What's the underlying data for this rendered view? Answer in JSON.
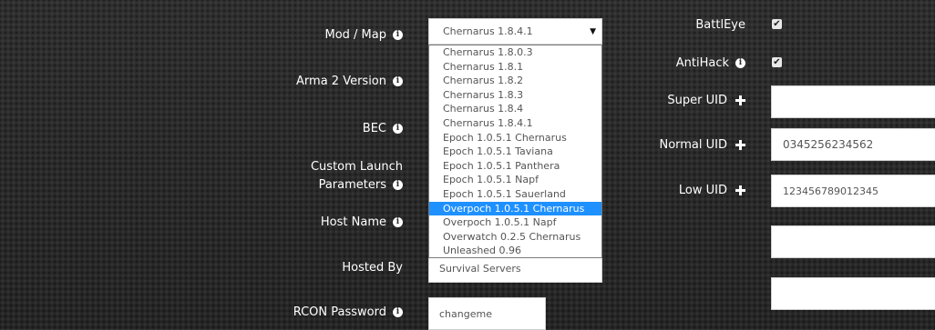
{
  "labels": {
    "mod_map": "Mod / Map",
    "arma2_version": "Arma 2 Version",
    "bec": "BEC",
    "custom_launch_line1": "Custom Launch",
    "custom_launch_line2": "Parameters",
    "host_name": "Host Name",
    "hosted_by": "Hosted By",
    "rcon_password": "RCON Password",
    "battleye": "BattlEye",
    "antihack": "AntiHack",
    "super_uid": "Super UID",
    "normal_uid": "Normal UID",
    "low_uid": "Low UID"
  },
  "mod_map_select": {
    "selected_value": "Chernarus 1.8.4.1",
    "options": [
      "Chernarus 1.8.0.3",
      "Chernarus 1.8.1",
      "Chernarus 1.8.2",
      "Chernarus 1.8.3",
      "Chernarus 1.8.4",
      "Chernarus 1.8.4.1",
      "Epoch 1.0.5.1 Chernarus",
      "Epoch 1.0.5.1 Taviana",
      "Epoch 1.0.5.1 Panthera",
      "Epoch 1.0.5.1 Napf",
      "Epoch 1.0.5.1 Sauerland",
      "Overpoch 1.0.5.1 Chernarus",
      "Overpoch 1.0.5.1 Napf",
      "Overwatch 0.2.5 Chernarus",
      "Unleashed 0.96"
    ],
    "highlighted": "Overpoch 1.0.5.1 Chernarus"
  },
  "fields": {
    "hosted_by_value": "Survival Servers",
    "rcon_password_value": "changeme",
    "super_uid_value": "",
    "normal_uid_value": "0345256234562",
    "low_uid_value": "123456789012345",
    "extra_value": ""
  },
  "checkboxes": {
    "battleye_checked": true,
    "antihack_checked": true,
    "check_glyph": "✔"
  },
  "icons": {
    "info": "info-icon",
    "plus": "plus-icon",
    "caret": "caret-down-icon"
  },
  "glyphs": {
    "info": "i",
    "caret": "▼"
  },
  "colors": {
    "highlight": "#1e90ff",
    "background": "#2b2b2b",
    "label_text": "#ffffff",
    "field_text": "#555555"
  }
}
